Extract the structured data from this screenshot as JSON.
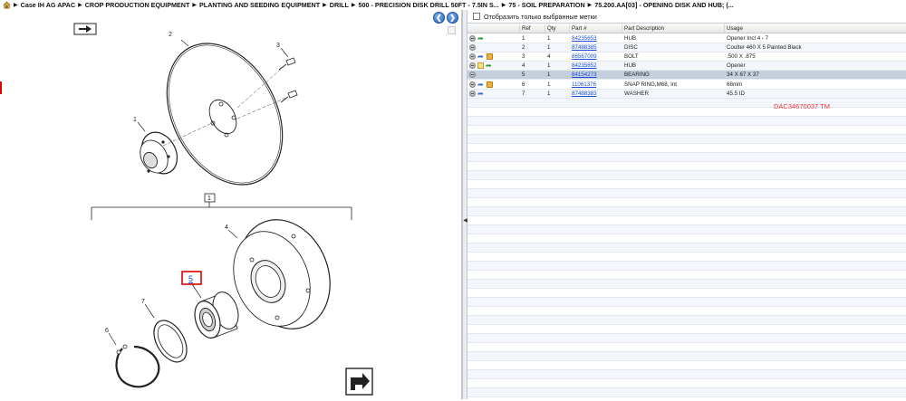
{
  "breadcrumb": {
    "items": [
      "Case IH AG APAC",
      "CROP PRODUCTION EQUIPMENT",
      "PLANTING AND SEEDING EQUIPMENT",
      "DRILL",
      "500 - PRECISION DISK DRILL 50FT - 7.5IN S...",
      "75 - SOIL PREPARATION",
      "75.200.AA[03] - OPENING DISK AND HUB; (..."
    ],
    "separator": "▶"
  },
  "diagram": {
    "callouts": {
      "c1": "1",
      "c2": "2",
      "c3": "3",
      "c4": "4",
      "c5": "5",
      "c6": "6",
      "c7": "7",
      "group": "1"
    }
  },
  "filter": {
    "label": "Отобразить только выбранные метки"
  },
  "grid": {
    "headers": {
      "ref": "Ref",
      "qty": "Qty",
      "part": "Part #",
      "desc": "Part Description",
      "usage": "Usage"
    },
    "rows": [
      {
        "ref": "1",
        "qty": "1",
        "part": "84235653",
        "desc": "HUB",
        "usage": "Opener Incl 4 - 7"
      },
      {
        "ref": "2",
        "qty": "1",
        "part": "87488385",
        "desc": "DISC",
        "usage": "Coulter 460 X 5 Painted Black"
      },
      {
        "ref": "3",
        "qty": "4",
        "part": "86567009",
        "desc": "BOLT",
        "usage": ".500 X .875"
      },
      {
        "ref": "4",
        "qty": "1",
        "part": "84235652",
        "desc": "HUB",
        "usage": "Opener"
      },
      {
        "ref": "5",
        "qty": "1",
        "part": "84154273",
        "desc": "BEARING",
        "usage": "34 X 67 X 37"
      },
      {
        "ref": "6",
        "qty": "1",
        "part": "11061376",
        "desc": "SNAP RING,M68, Int",
        "usage": "68mm"
      },
      {
        "ref": "7",
        "qty": "1",
        "part": "87488383",
        "desc": "WASHER",
        "usage": "45.5 ID"
      }
    ]
  },
  "annotation": "DAC34670037 TM",
  "colors": {
    "selection_outline": "#d9101f",
    "link": "#1c4fd6",
    "annotation": "#e8373f"
  }
}
